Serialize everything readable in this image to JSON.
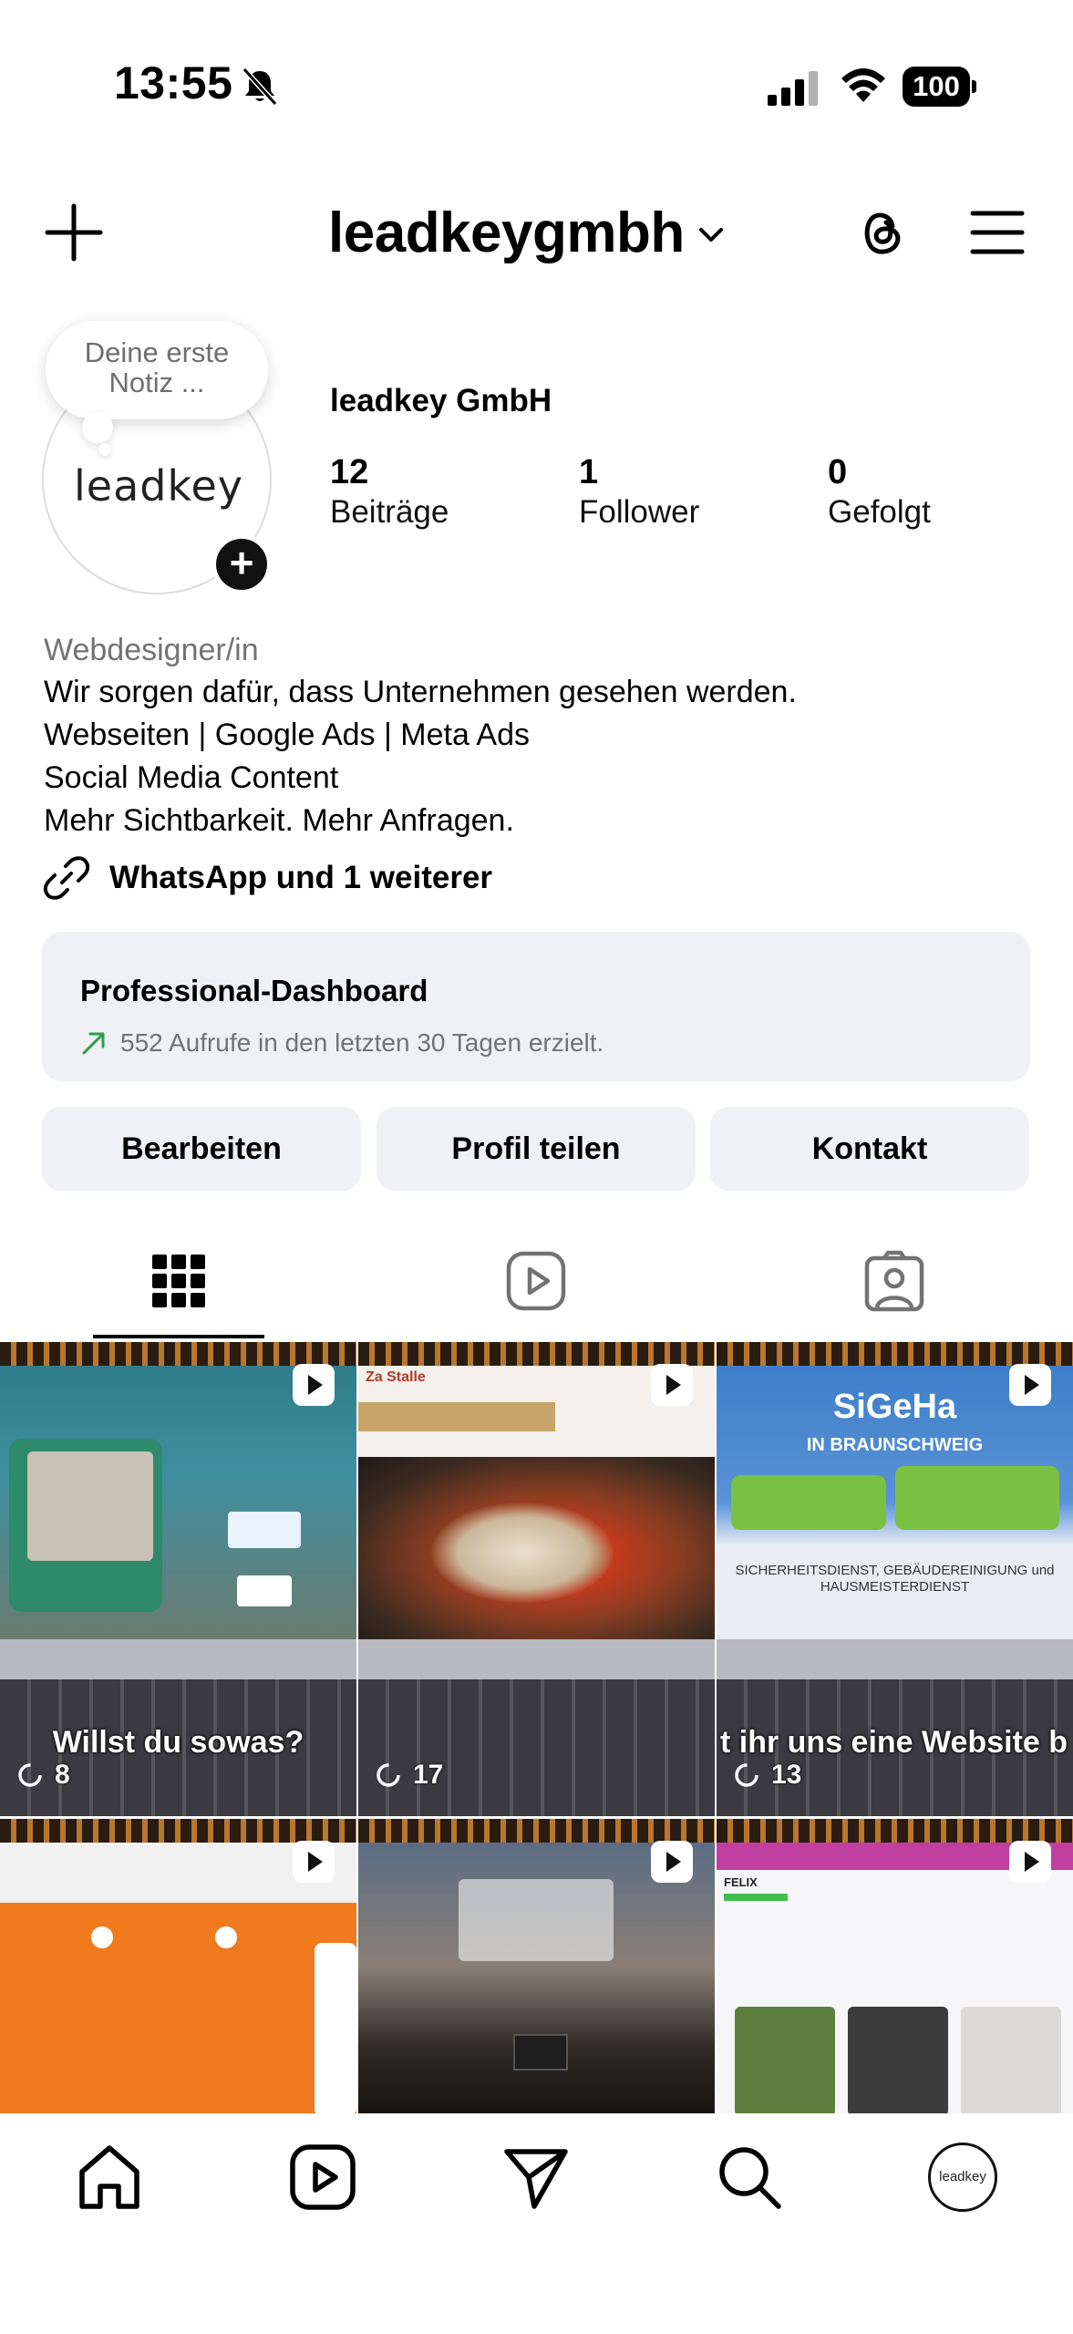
{
  "status_bar": {
    "time": "13:55",
    "battery": "100"
  },
  "header": {
    "username": "leadkeygmbh"
  },
  "profile": {
    "avatar_logo_text": "leadkey",
    "note_placeholder_line1": "Deine erste",
    "note_placeholder_line2": "Notiz ...",
    "display_name": "leadkey GmbH",
    "stats": [
      {
        "value": "12",
        "label": "Beiträge"
      },
      {
        "value": "1",
        "label": "Follower"
      },
      {
        "value": "0",
        "label": "Gefolgt"
      }
    ],
    "category": "Webdesigner/in",
    "bio_lines": [
      "Wir sorgen dafür, dass Unternehmen gesehen werden.",
      "Webseiten | Google Ads | Meta Ads",
      "Social Media Content",
      "Mehr Sichtbarkeit. Mehr Anfragen."
    ],
    "links_text": "WhatsApp und 1 weiterer"
  },
  "dashboard": {
    "title": "Professional-Dashboard",
    "subtitle": "552 Aufrufe in den letzten 30 Tagen erzielt.",
    "accent_color": "#2e9e4f"
  },
  "actions": {
    "edit": "Bearbeiten",
    "share": "Profil teilen",
    "contact": "Kontakt"
  },
  "tabs": [
    "grid-icon",
    "reels-icon",
    "tagged-icon"
  ],
  "posts": [
    {
      "caption": "Willst du sowas?",
      "views": "8"
    },
    {
      "caption": "",
      "views": "17",
      "screen_label": "Za Stalle"
    },
    {
      "caption": "t ihr uns eine Website b",
      "views": "13",
      "screen_title": "SiGeHa",
      "screen_subtitle": "IN BRAUNSCHWEIG",
      "screen_body": "SICHERHEITSDIENST, GEBÄUDEREINIGUNG und HAUSMEISTERDIENST"
    },
    {
      "caption": "",
      "views": ""
    },
    {
      "caption": "",
      "views": ""
    },
    {
      "caption": "",
      "views": "",
      "screen_label": "FELIX"
    }
  ],
  "bottom_nav": {
    "items": [
      "home-icon",
      "reels-icon",
      "messages-icon",
      "search-icon",
      "profile-avatar"
    ],
    "avatar_text": "leadkey"
  }
}
